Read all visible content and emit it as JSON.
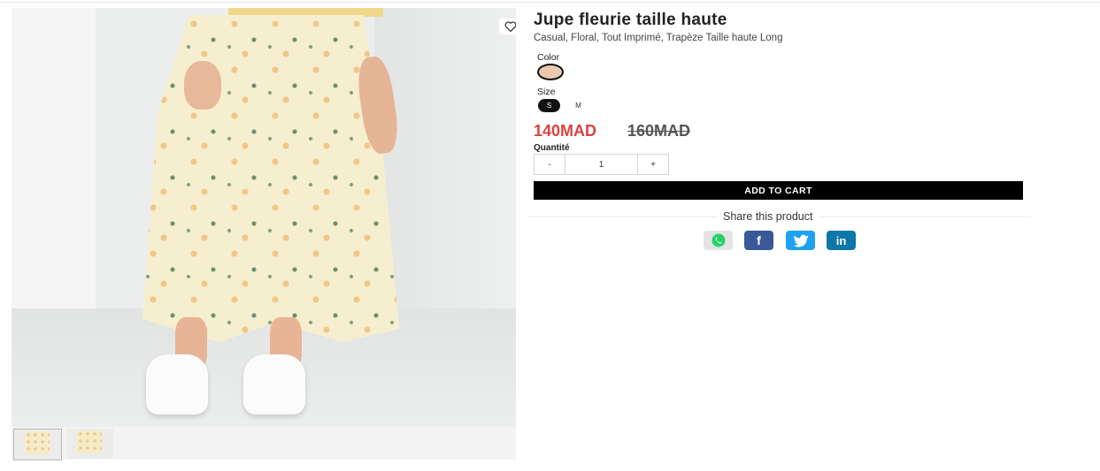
{
  "product": {
    "title": "Jupe fleurie taille haute",
    "tags": "Casual, Floral, Tout Imprimé, Trapèze Taille haute Long",
    "color_label": "Color",
    "color_swatch": "#e9c9b0",
    "size_label": "Size",
    "sizes": [
      {
        "label": "S",
        "selected": true
      },
      {
        "label": "M",
        "selected": false
      }
    ],
    "price_current": "140MAD",
    "price_old": "160MAD",
    "quantity_label": "Quantité",
    "quantity_minus": "-",
    "quantity_value": "1",
    "quantity_plus": "+",
    "add_to_cart": "ADD TO CART",
    "share_label": "Share this product",
    "share_icons": [
      "whatsapp-icon",
      "facebook-icon",
      "twitter-icon",
      "linkedin-icon"
    ]
  },
  "gallery": {
    "wishlist_icon": "heart-icon",
    "thumbnails": 2
  },
  "colors": {
    "price_sale": "#d9443f",
    "cart_button": "#000000",
    "facebook": "#3b5998",
    "twitter": "#1da1f2",
    "linkedin": "#0e76a8"
  }
}
